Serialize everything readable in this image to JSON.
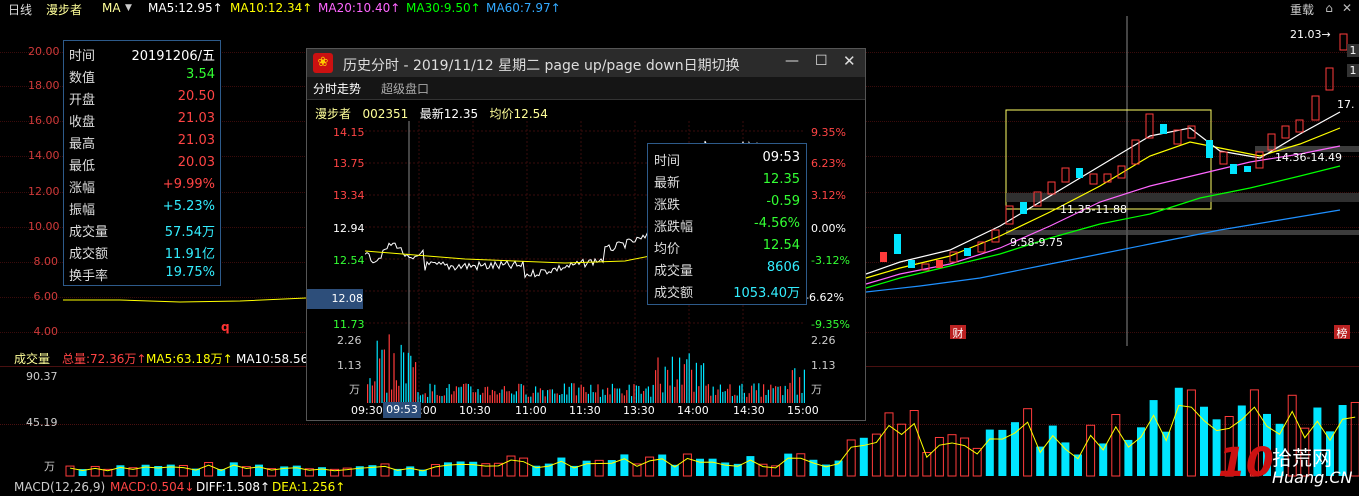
{
  "topbar": {
    "period": "日线",
    "stock": "漫步者",
    "indicator": "MA",
    "ma5": "MA5:12.95↑",
    "ma10": "MA10:12.34↑",
    "ma20": "MA20:10.40↑",
    "ma30": "MA30:9.50↑",
    "ma60": "MA60:7.97↑",
    "reset": "重载"
  },
  "kline": {
    "y_ticks": [
      "20.00",
      "18.00",
      "16.00",
      "14.00",
      "12.00",
      "10.00",
      "8.00",
      "6.00",
      "4.00"
    ],
    "annotations": {
      "top_right": "21.03→",
      "right_a": "1",
      "right_b": "1",
      "right_c": "17.",
      "range1": "11.35-11.88",
      "range2": "9.58-9.75",
      "range3": "14.36-14.49",
      "badge_cai": "财",
      "badge_bang": "榜",
      "marker_q": "q"
    }
  },
  "infobox": {
    "rows": [
      {
        "k": "时间",
        "v": "20191206/五"
      },
      {
        "k": "数值",
        "v": "3.54"
      },
      {
        "k": "开盘",
        "v": "20.50"
      },
      {
        "k": "收盘",
        "v": "21.03"
      },
      {
        "k": "最高",
        "v": "21.03"
      },
      {
        "k": "最低",
        "v": "20.03"
      },
      {
        "k": "涨幅",
        "v": "+9.99%"
      },
      {
        "k": "振幅",
        "v": "+5.23%"
      },
      {
        "k": "成交量",
        "v": "57.54万"
      },
      {
        "k": "成交额",
        "v": "11.91亿"
      },
      {
        "k": "换手率",
        "v": "19.75%"
      }
    ]
  },
  "volume": {
    "label": "成交量",
    "total": "总量:72.36万↑",
    "ma5": "MA5:63.18万↑",
    "ma10": "MA10:58.56万",
    "y_ticks": [
      "90.37",
      "45.19",
      "万"
    ]
  },
  "macd": {
    "label": "MACD(12,26,9)",
    "macd": "MACD:0.504↓",
    "diff": "DIFF:1.508↑",
    "dea": "DEA:1.256↑"
  },
  "window": {
    "title": "历史分时 - 2019/11/12 星期二 page up/page down日期切换",
    "tabs": [
      "分时走势",
      "超级盘口"
    ],
    "info": {
      "name": "漫步者",
      "code": "002351",
      "latest": "最新12.35",
      "avg": "均价12.54"
    },
    "left_prices": [
      "14.15",
      "13.75",
      "13.34",
      "12.94",
      "12.54",
      "12.08",
      "11.73"
    ],
    "right_pcts": [
      "9.35%",
      "6.23%",
      "3.12%",
      "0.00%",
      "-3.12%",
      "-6.62%",
      "-9.35%"
    ],
    "vol_left": [
      "2.26",
      "1.13",
      "万"
    ],
    "vol_right": [
      "2.26",
      "1.13",
      "万"
    ],
    "times": [
      "09:30",
      "10:00",
      "10:30",
      "11:00",
      "11:30",
      "13:30",
      "14:00",
      "14:30",
      "15:00"
    ],
    "cursor_time": "09:53",
    "box": [
      {
        "k": "时间",
        "v": "09:53"
      },
      {
        "k": "最新",
        "v": "12.35"
      },
      {
        "k": "涨跌",
        "v": "-0.59"
      },
      {
        "k": "涨跌幅",
        "v": "-4.56%"
      },
      {
        "k": "均价",
        "v": "12.54"
      },
      {
        "k": "成交量",
        "v": "8606"
      },
      {
        "k": "成交额",
        "v": "1053.40万"
      }
    ]
  },
  "watermark": {
    "num": "10",
    "text": "拾荒网",
    "url": "Huang.CN"
  },
  "colors": {
    "up": "#ff3b3b",
    "down": "#00e5ff",
    "ma5": "#ffffff",
    "ma10": "#ffff00",
    "ma20": "#ff66ff",
    "ma30": "#00ff00",
    "ma60": "#1e90ff"
  }
}
